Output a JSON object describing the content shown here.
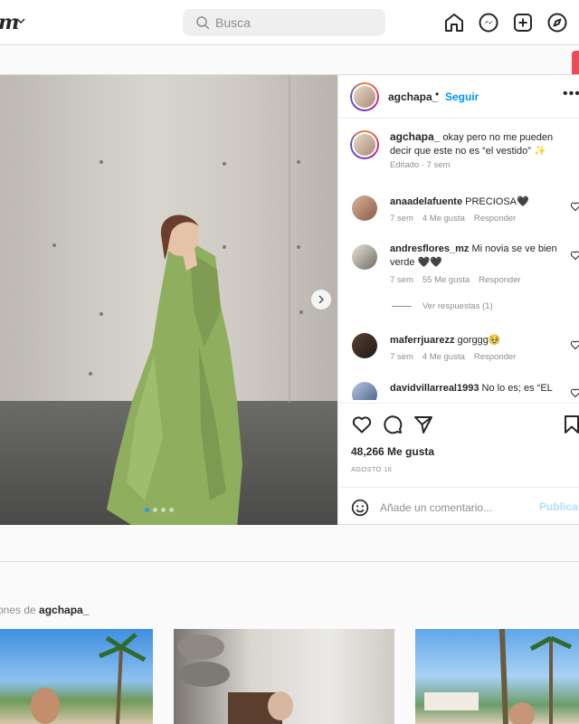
{
  "nav": {
    "logo_text": "m",
    "search_placeholder": "Busca",
    "icons": [
      "home-icon",
      "messenger-icon",
      "new-post-icon",
      "explore-icon"
    ]
  },
  "post": {
    "username": "agchapa_",
    "follow_label": "Seguir",
    "more_label": "•••",
    "caption_user": "agchapa_",
    "caption_text": "okay pero no me pueden decir que este no es “el vestido” ✨",
    "caption_meta": "Editado · 7 sem",
    "carousel": {
      "current_slide": 1,
      "total_slides": 4
    },
    "comments": [
      {
        "user": "anaadelafuente",
        "text": "PRECIOSA🖤",
        "time": "7 sem",
        "likes": "4 Me gusta",
        "reply": "Responder"
      },
      {
        "user": "andresflores_mz",
        "text": "Mi novia se ve bien verde 🖤🖤",
        "time": "7 sem",
        "likes": "55 Me gusta",
        "reply": "Responder",
        "view_replies": "Ver respuestas (1)"
      },
      {
        "user": "maferrjuarezz",
        "text": "gorggg🥹",
        "time": "7 sem",
        "likes": "4 Me gusta",
        "reply": "Responder"
      },
      {
        "user": "davidvillarreal1993",
        "text": "No lo es; es “EL"
      }
    ],
    "likes": "48,266 Me gusta",
    "date": "AGOSTO 16",
    "comment_placeholder": "Añade un comentario...",
    "publish_label": "Publicar"
  },
  "more_posts": {
    "prefix": "ones de",
    "user": "agchapa_"
  },
  "colors": {
    "accent": "#0095f6",
    "publish_disabled": "#b2dffc",
    "red_tab": "#ed4956",
    "dress": "#8fae5e"
  }
}
